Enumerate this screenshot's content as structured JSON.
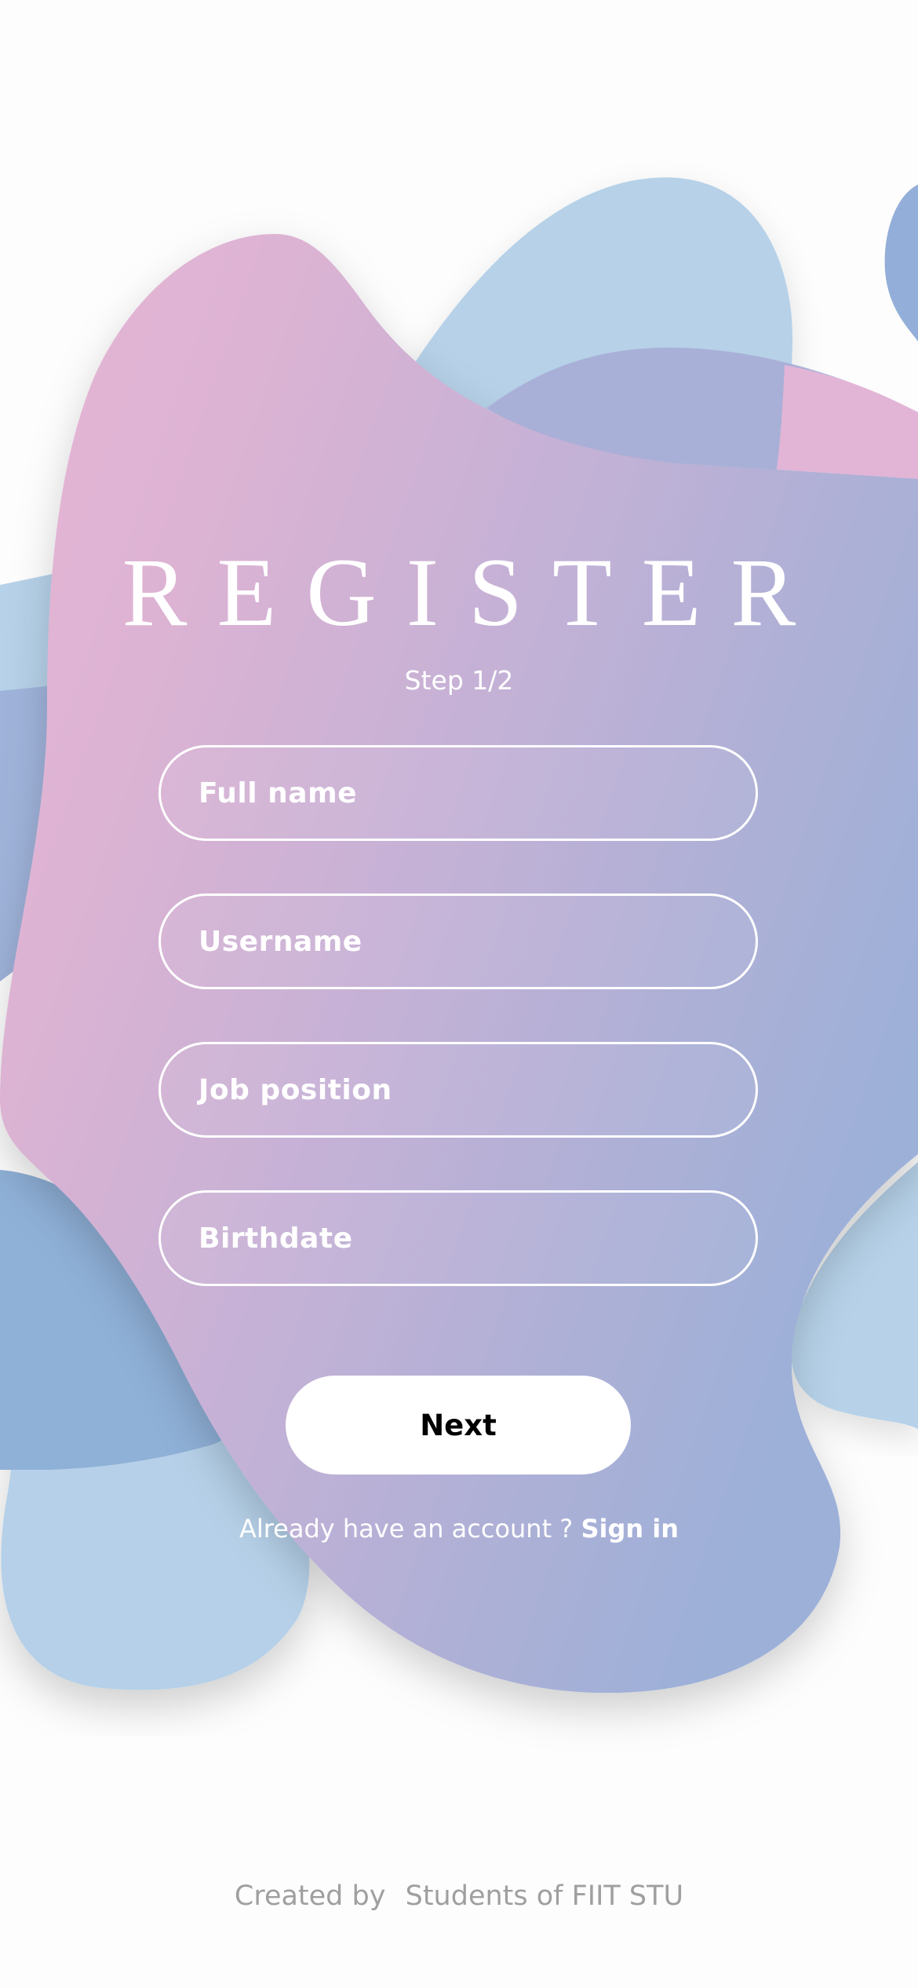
{
  "register": {
    "title": "REGISTER",
    "step": "Step 1/2"
  },
  "form": {
    "fields": [
      {
        "placeholder": "Full name"
      },
      {
        "placeholder": "Username"
      },
      {
        "placeholder": "Job position"
      },
      {
        "placeholder": "Birthdate"
      }
    ],
    "next_label": "Next"
  },
  "signin": {
    "prompt": "Already have an account ?",
    "link_label": "Sign in"
  },
  "footer": {
    "prefix": "Created by",
    "author": "Students of FIIT STU"
  },
  "colors": {
    "blob_pink": "#e6b4d5",
    "blob_lavender": "#a9aed6",
    "blob_light_blue": "#b6d1e8",
    "blob_blue": "#8fb0d7",
    "text_on_blob": "#ffffff",
    "footer_text": "#9f9f9f",
    "button_bg": "#ffffff",
    "button_text": "#000000"
  }
}
